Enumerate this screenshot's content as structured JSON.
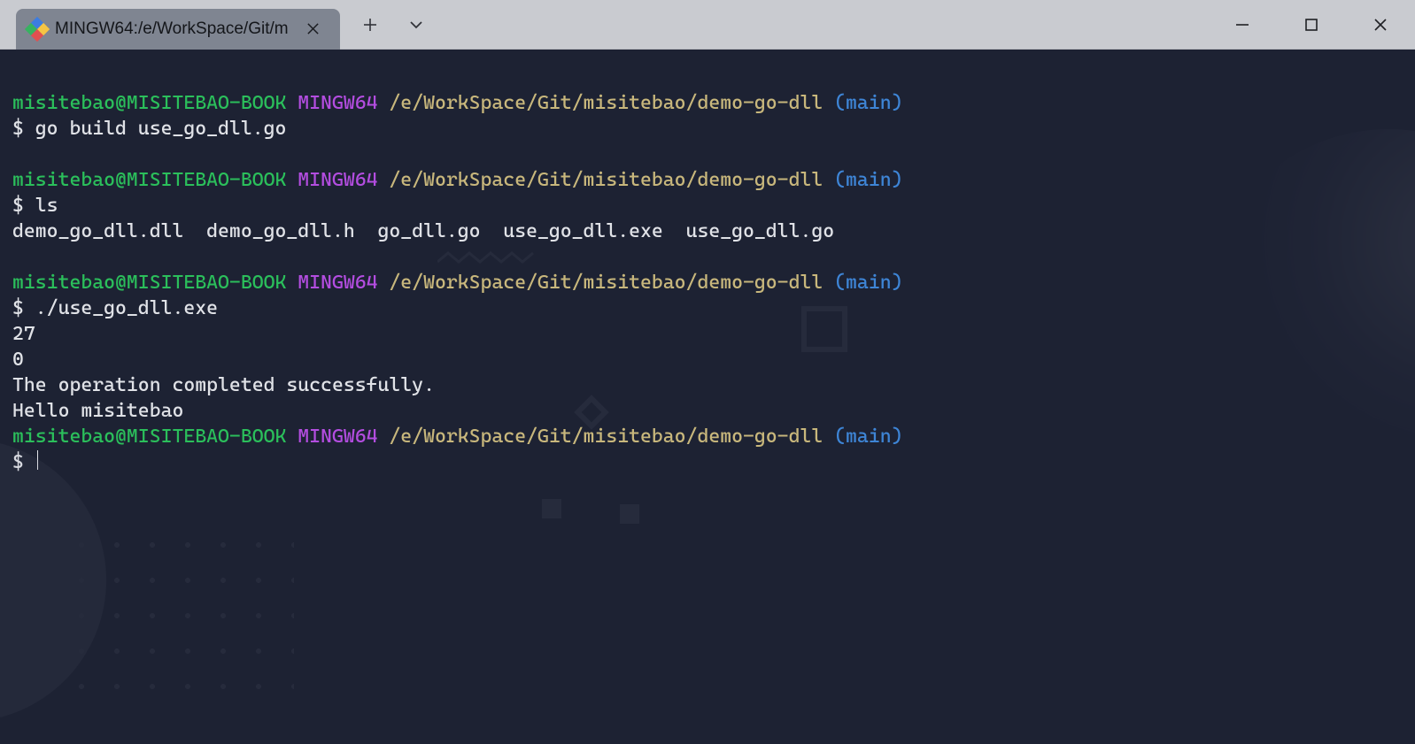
{
  "colors": {
    "title_bar": "#c9cbd0",
    "tab_bg": "#7f8591",
    "terminal_bg": "#1d2233",
    "prompt_user_host": "#2bbf5b",
    "prompt_system": "#b34de0",
    "prompt_path": "#c8b77c",
    "prompt_branch": "#3e85d6",
    "terminal_fg": "#e0e2e7"
  },
  "tab": {
    "title": "MINGW64:/e/WorkSpace/Git/m"
  },
  "blocks": [
    {
      "prompt": {
        "user_host": "misitebao@MISITEBAO-BOOK",
        "system": "MINGW64",
        "path": "/e/WorkSpace/Git/misitebao/demo-go-dll",
        "branch": "(main)"
      },
      "command": "go build use_go_dll.go",
      "output_lines": []
    },
    {
      "prompt": {
        "user_host": "misitebao@MISITEBAO-BOOK",
        "system": "MINGW64",
        "path": "/e/WorkSpace/Git/misitebao/demo-go-dll",
        "branch": "(main)"
      },
      "command": "ls",
      "output_lines": [
        "demo_go_dll.dll  demo_go_dll.h  go_dll.go  use_go_dll.exe  use_go_dll.go"
      ]
    },
    {
      "prompt": {
        "user_host": "misitebao@MISITEBAO-BOOK",
        "system": "MINGW64",
        "path": "/e/WorkSpace/Git/misitebao/demo-go-dll",
        "branch": "(main)"
      },
      "command": "./use_go_dll.exe",
      "output_lines": [
        "27",
        "0",
        "The operation completed successfully.",
        "Hello misitebao"
      ]
    },
    {
      "prompt": {
        "user_host": "misitebao@MISITEBAO-BOOK",
        "system": "MINGW64",
        "path": "/e/WorkSpace/Git/misitebao/demo-go-dll",
        "branch": "(main)"
      },
      "command": "",
      "cursor": true,
      "output_lines": []
    }
  ]
}
